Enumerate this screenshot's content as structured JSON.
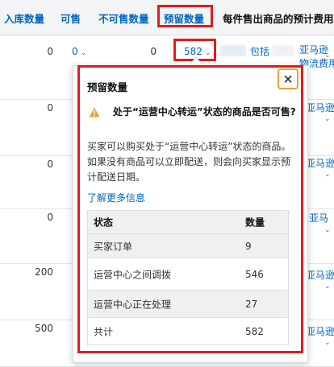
{
  "header": {
    "col_inbound": "入库数量",
    "col_sellable": "可售",
    "col_unsellable": "不可售数量",
    "col_reserved": "预留数量",
    "col_fee": "每件售出商品的预计费用"
  },
  "rows": [
    {
      "inbound": "0",
      "sellable": "0",
      "unsellable": "0",
      "reserved": "582",
      "fee_prefix": "包括",
      "fee_link": "亚马逊",
      "fee_link2": "物流费用"
    },
    {
      "inbound": "0",
      "fee_link": "亚马逊"
    },
    {
      "inbound": "0",
      "fee_link": "亚马逊"
    },
    {
      "inbound": "0",
      "fee_link": "亚马"
    },
    {
      "inbound": "200",
      "fee_link": "亚马逊"
    },
    {
      "inbound": "500",
      "fee_link": "亚马逊"
    }
  ],
  "popover": {
    "title": "预留数量",
    "close_glyph": "×",
    "warning": "处于“运营中心转运”状态的商品是否可售?",
    "description": "买家可以购买处于“运营中心转运”状态的商品。如果没有商品可以立即配送，则会向买家显示预计配送日期。",
    "learn_more": "了解更多信息",
    "table": {
      "head_status": "状态",
      "head_qty": "数量",
      "rows": [
        {
          "status": "买家订单",
          "qty": "9"
        },
        {
          "status": "运营中心之间调拨",
          "qty": "546"
        },
        {
          "status": "运营中心正在处理",
          "qty": "27"
        },
        {
          "status": "共计",
          "qty": "582"
        }
      ]
    }
  },
  "icons": {
    "warning": "warning-icon",
    "chevron": "chevron-down-icon",
    "close": "close-icon"
  },
  "colors": {
    "link": "#0066c0",
    "highlight": "#e31b1b",
    "warning": "#e8a33a"
  }
}
